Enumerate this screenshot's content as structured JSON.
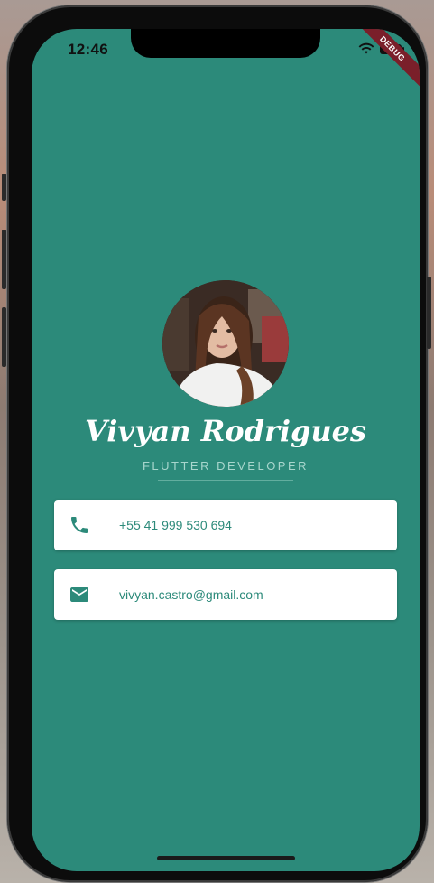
{
  "status_bar": {
    "time": "12:46",
    "debug_label": "DEBUG",
    "icons": [
      "wifi-icon",
      "battery-icon"
    ]
  },
  "profile": {
    "name": "Vivyan Rodrigues",
    "title": "FLUTTER DEVELOPER",
    "avatar": "profile-photo"
  },
  "contacts": [
    {
      "icon": "phone-icon",
      "text": "+55 41 999 530 694"
    },
    {
      "icon": "mail-icon",
      "text": "vivyan.castro@gmail.com"
    }
  ],
  "colors": {
    "background": "#2c8a7a",
    "card": "#ffffff",
    "accent_text": "#2c8a7a",
    "subtitle": "#a8d6cd"
  }
}
